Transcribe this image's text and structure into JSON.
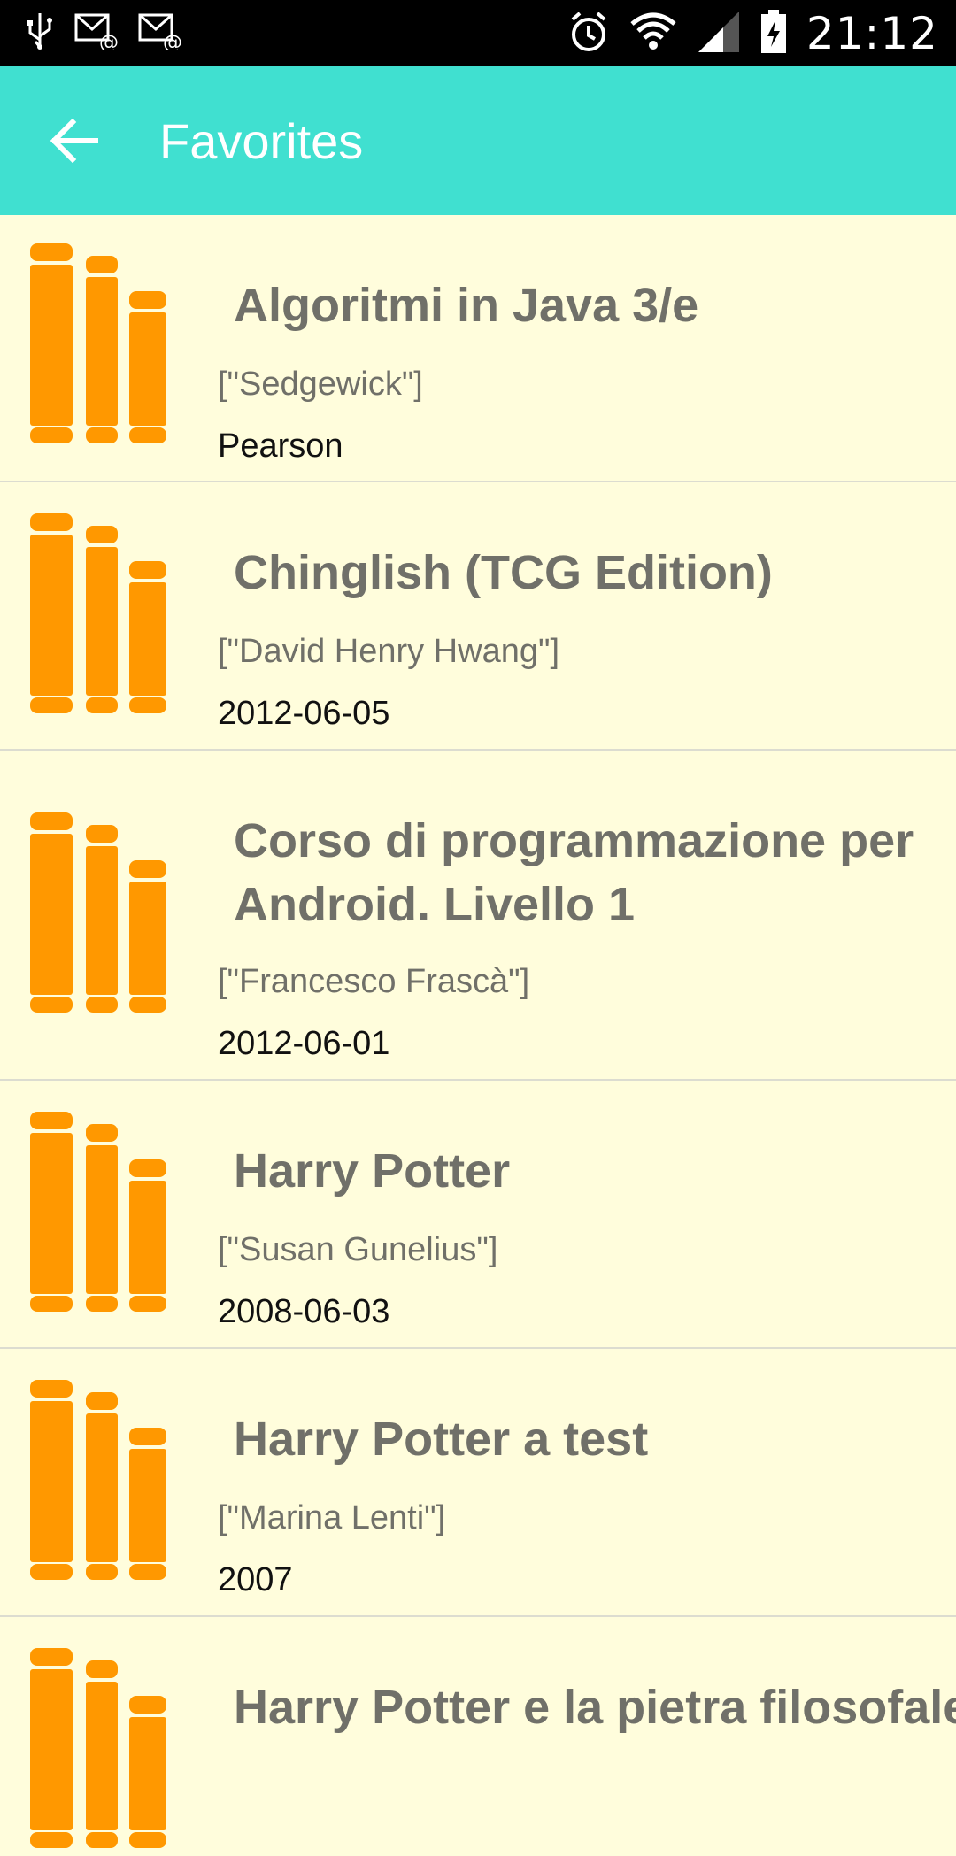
{
  "status_bar": {
    "time": "21:12",
    "icons": [
      "usb-icon",
      "mail-icon",
      "mail-icon",
      "alarm-icon",
      "wifi-icon",
      "signal-icon",
      "battery-charging-icon"
    ]
  },
  "app_bar": {
    "title": "Favorites",
    "back_icon": "arrow-left-icon",
    "color": "#40e0d0"
  },
  "accent_color": "#ff9800",
  "books": [
    {
      "title": "Algoritmi in Java 3/e",
      "author": "[\"Sedgewick\"]",
      "meta": "Pearson"
    },
    {
      "title": "Chinglish (TCG Edition)",
      "author": "[\"David Henry Hwang\"]",
      "meta": "2012-06-05"
    },
    {
      "title": "Corso di programmazione per Android. Livello 1",
      "author": "[\"Francesco Frascà\"]",
      "meta": "2012-06-01"
    },
    {
      "title": "Harry Potter",
      "author": "[\"Susan Gunelius\"]",
      "meta": "2008-06-03"
    },
    {
      "title": "Harry Potter a test",
      "author": "[\"Marina Lenti\"]",
      "meta": "2007"
    },
    {
      "title": "Harry Potter e la pietra filosofale",
      "author": "",
      "meta": ""
    }
  ]
}
